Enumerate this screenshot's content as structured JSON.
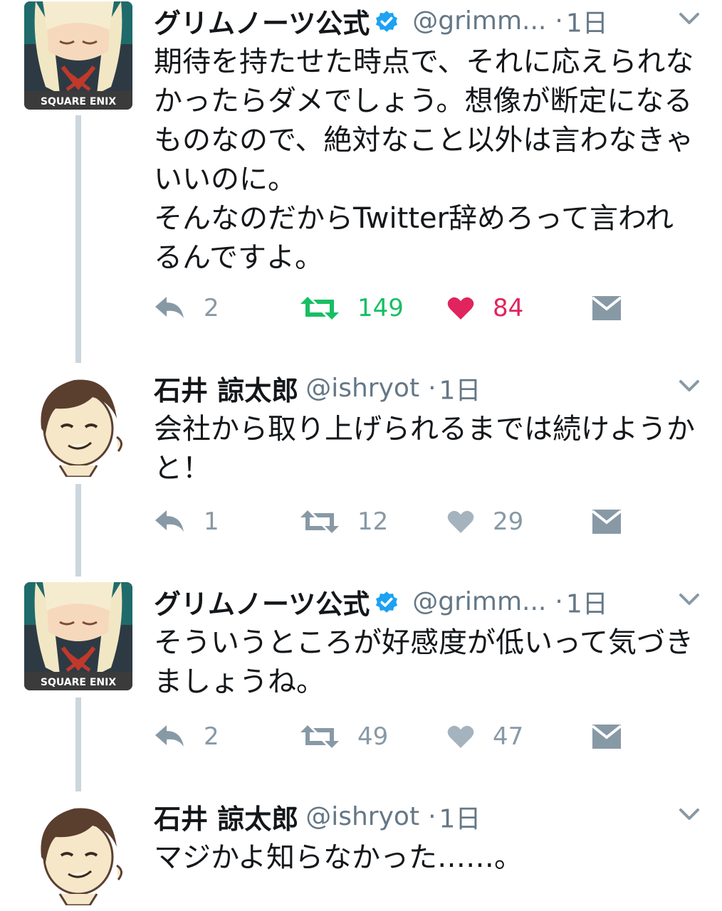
{
  "colors": {
    "text": "#14171a",
    "muted": "#8899a6",
    "handle": "#657786",
    "retweet_active": "#17bf63",
    "like_active": "#e0245e",
    "verified": "#1da1f2",
    "thread_line": "#ccd6dd"
  },
  "tweets": [
    {
      "name": "グリムノーツ公式",
      "verified": true,
      "handle": "@grimm...",
      "dot": "·",
      "time": "1日",
      "text": "期待を持たせた時点で、それに応えられなかったらダメでしょう。想像が断定になるものなので、絶対なこと以外は言わなきゃいいのに。\nそんなのだからTwitter辞めろって言われるんですよ。",
      "avatar_label": "SQUARE ENIX",
      "replies": "2",
      "retweets": "149",
      "likes": "84",
      "retweeted": true,
      "liked": true
    },
    {
      "name": "石井 諒太郎",
      "verified": false,
      "handle": "@ishryot",
      "dot": "·",
      "time": "1日",
      "text": "会社から取り上げられるまでは続けようかと！",
      "replies": "1",
      "retweets": "12",
      "likes": "29",
      "retweeted": false,
      "liked": false
    },
    {
      "name": "グリムノーツ公式",
      "verified": true,
      "handle": "@grimm...",
      "dot": "·",
      "time": "1日",
      "text": "そういうところが好感度が低いって気づきましょうね。",
      "avatar_label": "SQUARE ENIX",
      "replies": "2",
      "retweets": "49",
      "likes": "47",
      "retweeted": false,
      "liked": false
    },
    {
      "name": "石井 諒太郎",
      "verified": false,
      "handle": "@ishryot",
      "dot": "·",
      "time": "1日",
      "text": "マジかよ知らなかった……。"
    }
  ]
}
